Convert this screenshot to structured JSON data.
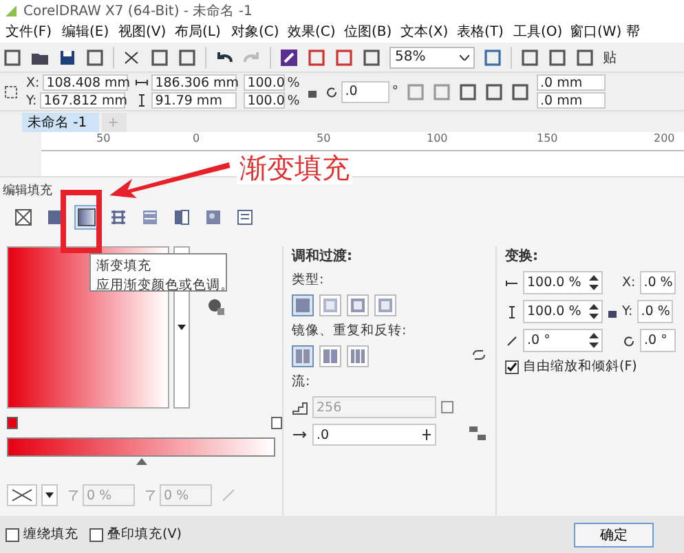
{
  "window": {
    "title": "CorelDRAW X7 (64-Bit) - 未命名 -1"
  },
  "menu": [
    "文件(F)",
    "编辑(E)",
    "视图(V)",
    "布局(L)",
    "对象(C)",
    "效果(C)",
    "位图(B)",
    "文本(X)",
    "表格(T)",
    "工具(O)",
    "窗口(W)",
    "帮"
  ],
  "toolbar": {
    "zoom": "58%",
    "cut_label": "贴"
  },
  "property_bar": {
    "position": [
      {
        "label": "X:",
        "value": "108.408 mm"
      },
      {
        "label": "Y:",
        "value": "167.812 mm"
      }
    ],
    "size": [
      "186.306 mm",
      "91.79 mm"
    ],
    "scale": [
      {
        "value": "100.0",
        "unit": "%"
      },
      {
        "value": "100.0",
        "unit": "%"
      }
    ],
    "rotation": {
      "value": ".0",
      "unit": "°"
    },
    "corners": [
      ".0 mm",
      ".0 mm"
    ]
  },
  "document_tabs": [
    {
      "label": "未命名 -1",
      "selected": true
    },
    {
      "label": "+",
      "selected": false
    }
  ],
  "ruler": [
    "50",
    "0",
    "50",
    "100",
    "150",
    "200"
  ],
  "annotation": {
    "text": "渐变填充"
  },
  "dialog": {
    "title": "编辑填充",
    "fill_types": [
      {
        "kind": "none",
        "selected": false
      },
      {
        "kind": "uniform",
        "selected": false
      },
      {
        "kind": "gradient",
        "selected": true
      },
      {
        "kind": "vector",
        "selected": false
      },
      {
        "kind": "bitmap",
        "selected": false
      },
      {
        "kind": "two_color",
        "selected": false
      },
      {
        "kind": "texture",
        "selected": false
      },
      {
        "kind": "postscript",
        "selected": false
      }
    ],
    "tooltip": {
      "title": "渐变填充",
      "text": "应用渐变颜色或色调。"
    },
    "blend": {
      "heading": "调和过渡:",
      "type_label": "类型:",
      "types": [
        {
          "selected": true
        },
        {
          "selected": false
        },
        {
          "selected": false
        },
        {
          "selected": false
        }
      ],
      "mirror_label": "镜像、重复和反转:",
      "mirror": [
        {
          "selected": true
        },
        {
          "selected": false
        },
        {
          "selected": false
        }
      ],
      "flow_label": "流:",
      "steps": {
        "value": "256",
        "disabled": true
      },
      "acceleration": ".0"
    },
    "transform": {
      "heading": "变换:",
      "size_fields": [
        "100.0 %",
        "100.0 %",
        ".0 °"
      ],
      "offset_fields": [
        {
          "label": "X:",
          "value": ".0 %"
        },
        {
          "label": "Y:",
          "value": ".0 %"
        },
        {
          "value": ".0 °"
        }
      ],
      "free_scale": {
        "label": "自由缩放和倾斜(F)",
        "checked": true
      }
    },
    "gradient": {
      "midpoint": {
        "level": 0.5
      }
    },
    "transparency": [
      "0 %",
      "0 %"
    ]
  },
  "footer": {
    "options": [
      {
        "label": "缠绕填充",
        "checked": false
      },
      {
        "label": "叠印填充(V)",
        "checked": false
      }
    ],
    "ok": "确定"
  }
}
